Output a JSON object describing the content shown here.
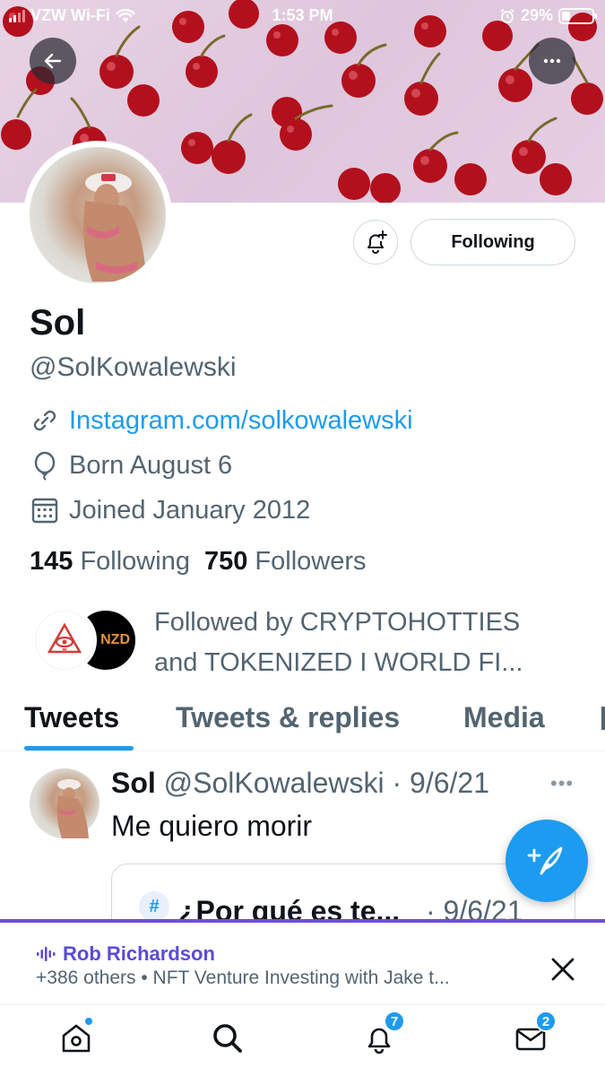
{
  "status_bar": {
    "carrier": "VZW Wi-Fi",
    "time": "1:53 PM",
    "battery": "29%"
  },
  "profile": {
    "display_name": "Sol",
    "handle": "@SolKowalewski",
    "website": "Instagram.com/solkowalewski",
    "birthday": "Born August 6",
    "joined": "Joined January 2012",
    "following_count": "145",
    "following_label": "Following",
    "followers_count": "750",
    "followers_label": "Followers",
    "follow_button_label": "Following",
    "followed_by_line1": "Followed by CRYPTOHOTTIES",
    "followed_by_line2": "and TOKENIZED I WORLD FI...",
    "follower_avatar_2_text": "NZD"
  },
  "tabs": [
    {
      "label": "Tweets",
      "active": true
    },
    {
      "label": "Tweets & replies",
      "active": false
    },
    {
      "label": "Media",
      "active": false
    }
  ],
  "tweet": {
    "author_name": "Sol",
    "author_handle": "@SolKowalewski",
    "date": "9/6/21",
    "text": "Me quiero morir",
    "quote_tag": "#",
    "quote_title": "¿Por qué es te...",
    "quote_date": "· 9/6/21"
  },
  "spaces": {
    "host": "Rob Richardson",
    "subtitle": "+386 others • NFT Venture Investing with Jake t..."
  },
  "bottom_nav": {
    "notifications_badge": "7",
    "messages_badge": "2"
  },
  "colors": {
    "accent": "#1d9bf0",
    "spaces_purple": "#6c4ce6",
    "secondary_text": "#536471"
  }
}
